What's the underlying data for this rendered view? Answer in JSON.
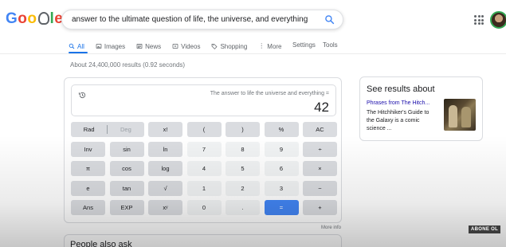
{
  "header": {
    "logo_text": "Google",
    "search_query": "answer to the ultimate question of life, the universe, and everything",
    "search_icon": "search-icon",
    "apps_icon": "apps-grid-icon",
    "avatar": "avatar"
  },
  "tabs": {
    "items": [
      {
        "label": "All",
        "icon": "search-icon",
        "active": true
      },
      {
        "label": "Images",
        "icon": "image-icon"
      },
      {
        "label": "News",
        "icon": "news-icon"
      },
      {
        "label": "Videos",
        "icon": "video-icon"
      },
      {
        "label": "Shopping",
        "icon": "tag-icon"
      },
      {
        "label": "More",
        "icon": "more-vert-icon"
      }
    ],
    "settings_label": "Settings",
    "tools_label": "Tools"
  },
  "result_stats": "About 24,400,000 results (0.92 seconds)",
  "calculator": {
    "expression": "The answer to life the universe and everything =",
    "result": "42",
    "history_icon": "history-icon",
    "rad_label": "Rad",
    "deg_label": "Deg",
    "keys": [
      {
        "label": "x!"
      },
      {
        "label": "("
      },
      {
        "label": ")"
      },
      {
        "label": "%"
      },
      {
        "label": "AC"
      },
      {
        "label": "Inv"
      },
      {
        "label": "sin"
      },
      {
        "label": "ln"
      },
      {
        "label": "7"
      },
      {
        "label": "8"
      },
      {
        "label": "9"
      },
      {
        "label": "÷"
      },
      {
        "label": "π"
      },
      {
        "label": "cos"
      },
      {
        "label": "log"
      },
      {
        "label": "4"
      },
      {
        "label": "5"
      },
      {
        "label": "6"
      },
      {
        "label": "×"
      },
      {
        "label": "e"
      },
      {
        "label": "tan"
      },
      {
        "label": "√"
      },
      {
        "label": "1"
      },
      {
        "label": "2"
      },
      {
        "label": "3"
      },
      {
        "label": "−"
      },
      {
        "label": "Ans"
      },
      {
        "label": "EXP"
      },
      {
        "label": "xʸ"
      },
      {
        "label": "0"
      },
      {
        "label": "."
      },
      {
        "label": "="
      },
      {
        "label": "+"
      }
    ],
    "more_info": "More info"
  },
  "people_also_ask": {
    "title": "People also ask"
  },
  "side_panel": {
    "title": "See results about",
    "link": "Phrases from The Hitch...",
    "description": "The Hitchhiker's Guide to the Galaxy is a comic science ..."
  },
  "watermark": "ABONE OL",
  "colors": {
    "accent": "#1a73e8",
    "equals_button": "#4285f4",
    "link": "#1a0dab"
  }
}
